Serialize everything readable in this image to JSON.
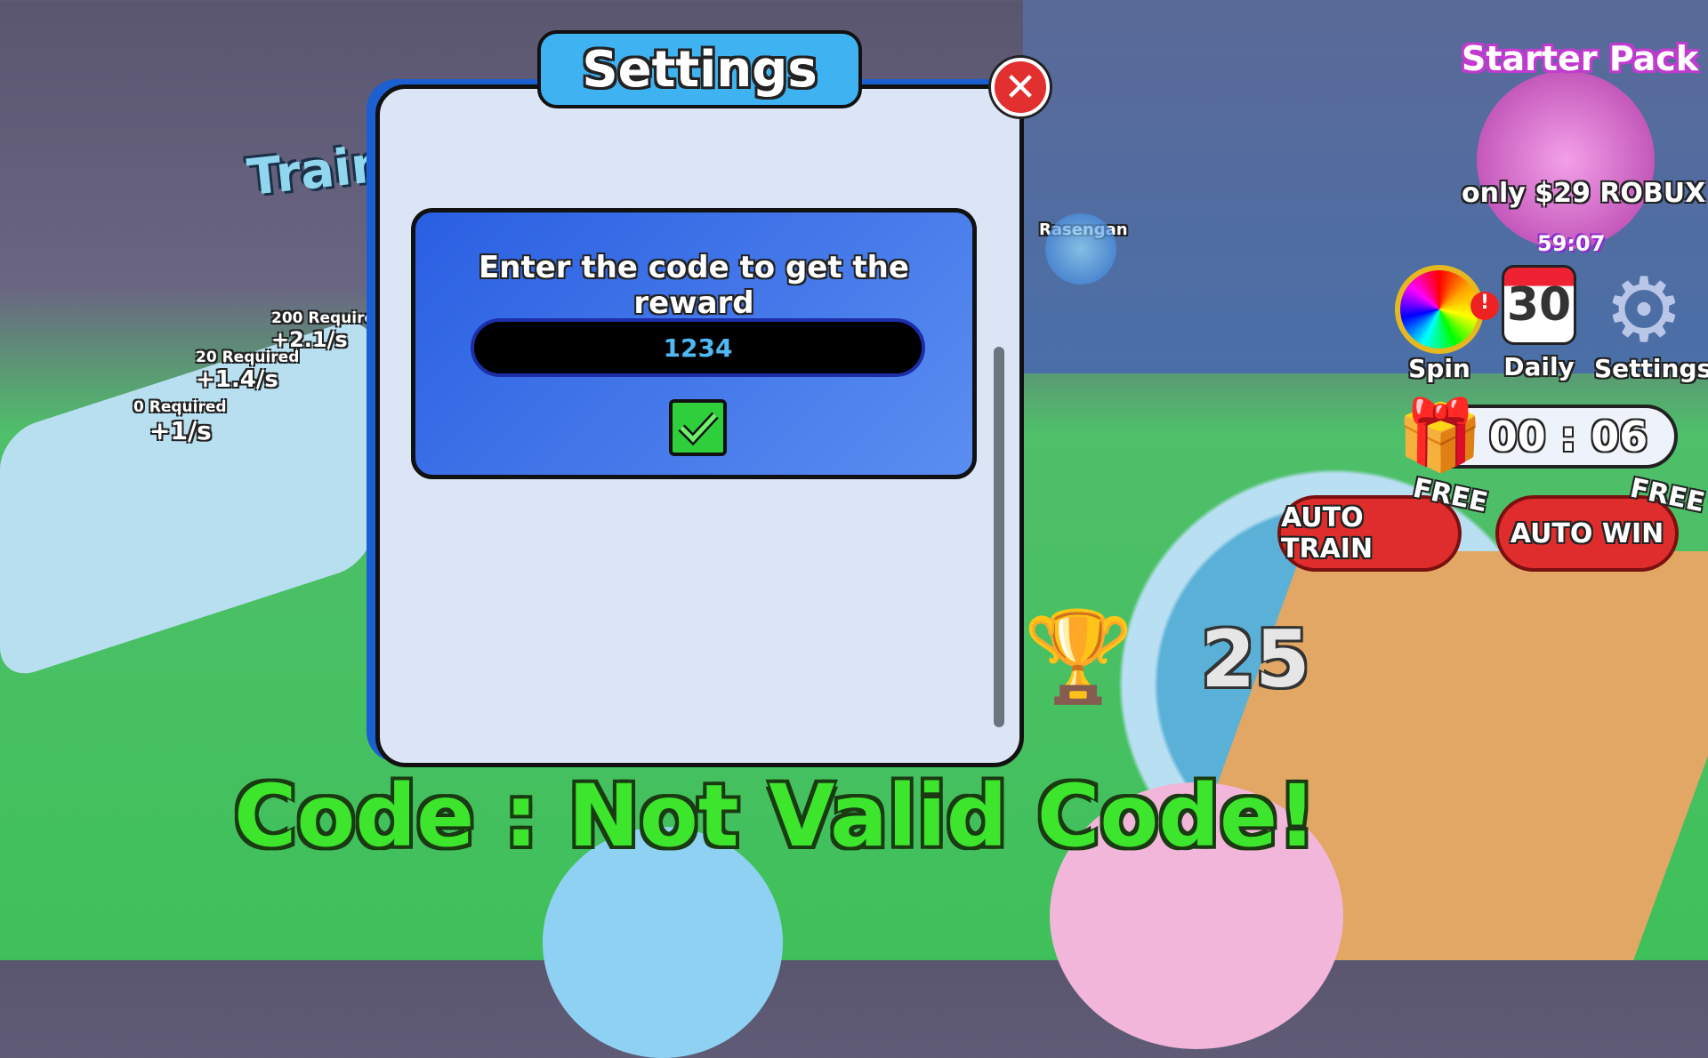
{
  "scene": {
    "sign": "Train",
    "rasengan": "Rasengan",
    "trainers": [
      {
        "req": "200 Required",
        "rate": "+2.1/s"
      },
      {
        "req": "20 Required",
        "rate": "+1.4/s"
      },
      {
        "req": "0 Required",
        "rate": "+1/s"
      }
    ]
  },
  "dialog": {
    "title": "Settings",
    "prompt": "Enter the code to get the reward",
    "code_value": "1234",
    "close_icon": "close-x-icon",
    "submit_icon": "checkmark-icon"
  },
  "result_message": "Code : Not Valid Code!",
  "wins": "25",
  "starter_pack": {
    "title": "Starter Pack",
    "price": "only $29 ROBUX",
    "timer": "59:07"
  },
  "menu": [
    {
      "label": "Spin",
      "icon": "wheel-icon"
    },
    {
      "label": "Daily",
      "icon": "calendar-icon",
      "badge": "30"
    },
    {
      "label": "Settings",
      "icon": "gear-icon"
    }
  ],
  "gift_timer": "00 : 06",
  "auto": [
    {
      "label": "AUTO TRAIN",
      "tag": "FREE"
    },
    {
      "label": "AUTO WIN",
      "tag": "FREE"
    }
  ],
  "colors": {
    "panel": "#dbe5f6",
    "title_tab": "#3fb3f2",
    "code_box": "#2a5fe2",
    "result_text": "#3de52c",
    "close": "#e23030",
    "auto_button": "#df2d2d",
    "starter_pack": "#e050e8"
  }
}
